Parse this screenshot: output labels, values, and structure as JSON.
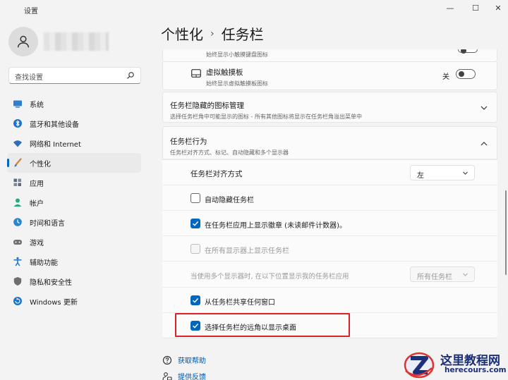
{
  "window": {
    "title": "设置",
    "minimize_glyph": "—",
    "maximize_glyph": "☐",
    "close_glyph": "✕"
  },
  "search": {
    "placeholder": "查找设置"
  },
  "sidebar": {
    "items": [
      {
        "label": "系统",
        "icon": "monitor-icon",
        "color": "#2f7fd1"
      },
      {
        "label": "蓝牙和其他设备",
        "icon": "bluetooth-icon",
        "color": "#1e73c8"
      },
      {
        "label": "网络和 Internet",
        "icon": "wifi-icon",
        "color": "#2a6fb8"
      },
      {
        "label": "个性化",
        "icon": "brush-icon",
        "color": "#d6813a",
        "active": true
      },
      {
        "label": "应用",
        "icon": "apps-icon",
        "color": "#5a6b82"
      },
      {
        "label": "帐户",
        "icon": "account-icon",
        "color": "#2aa876"
      },
      {
        "label": "时间和语言",
        "icon": "globe-clock-icon",
        "color": "#2a86c9"
      },
      {
        "label": "游戏",
        "icon": "gamepad-icon",
        "color": "#707070"
      },
      {
        "label": "辅助功能",
        "icon": "accessibility-icon",
        "color": "#1e73c8"
      },
      {
        "label": "隐私和安全性",
        "icon": "shield-icon",
        "color": "#6e6e6e"
      },
      {
        "label": "Windows 更新",
        "icon": "update-icon",
        "color": "#1e73c8"
      }
    ]
  },
  "header": {
    "crumb1": "个性化",
    "separator": "›",
    "crumb2": "任务栏"
  },
  "main": {
    "partial_top_text": "始终显示小触摸键盘图标",
    "virtual_touchpad": {
      "title": "虚拟触摸板",
      "subtitle": "始终显示虚拟触摸板图标",
      "state_label": "关"
    },
    "hidden_icons": {
      "title": "任务栏隐藏的图标管理",
      "subtitle": "选择任务栏角中可能显示的图标 - 所有其他图标将显示在任务栏角溢出菜单中"
    },
    "behaviors": {
      "title": "任务栏行为",
      "subtitle": "任务栏对齐方式、标记、自动隐藏和多个显示器",
      "alignment_label": "任务栏对齐方式",
      "alignment_value": "左",
      "auto_hide": "自动隐藏任务栏",
      "badges": "在任务栏应用上显示徽章 (未读邮件计数器)。",
      "all_displays": "在所有显示器上显示任务栏",
      "multi_display_label": "当使用多个显示器时, 在以下位置显示我的任务栏应用",
      "multi_display_value": "所有任务栏",
      "share_window": "从任务栏共享任何窗口",
      "corner_desktop": "选择任务栏的远角以显示桌面"
    }
  },
  "links": {
    "help": "获取帮助",
    "feedback": "提供反馈"
  },
  "watermark": {
    "cn": "这里教程网",
    "en": "herecours.com"
  },
  "colors": {
    "accent": "#0067c0",
    "highlight": "#d9222a"
  }
}
